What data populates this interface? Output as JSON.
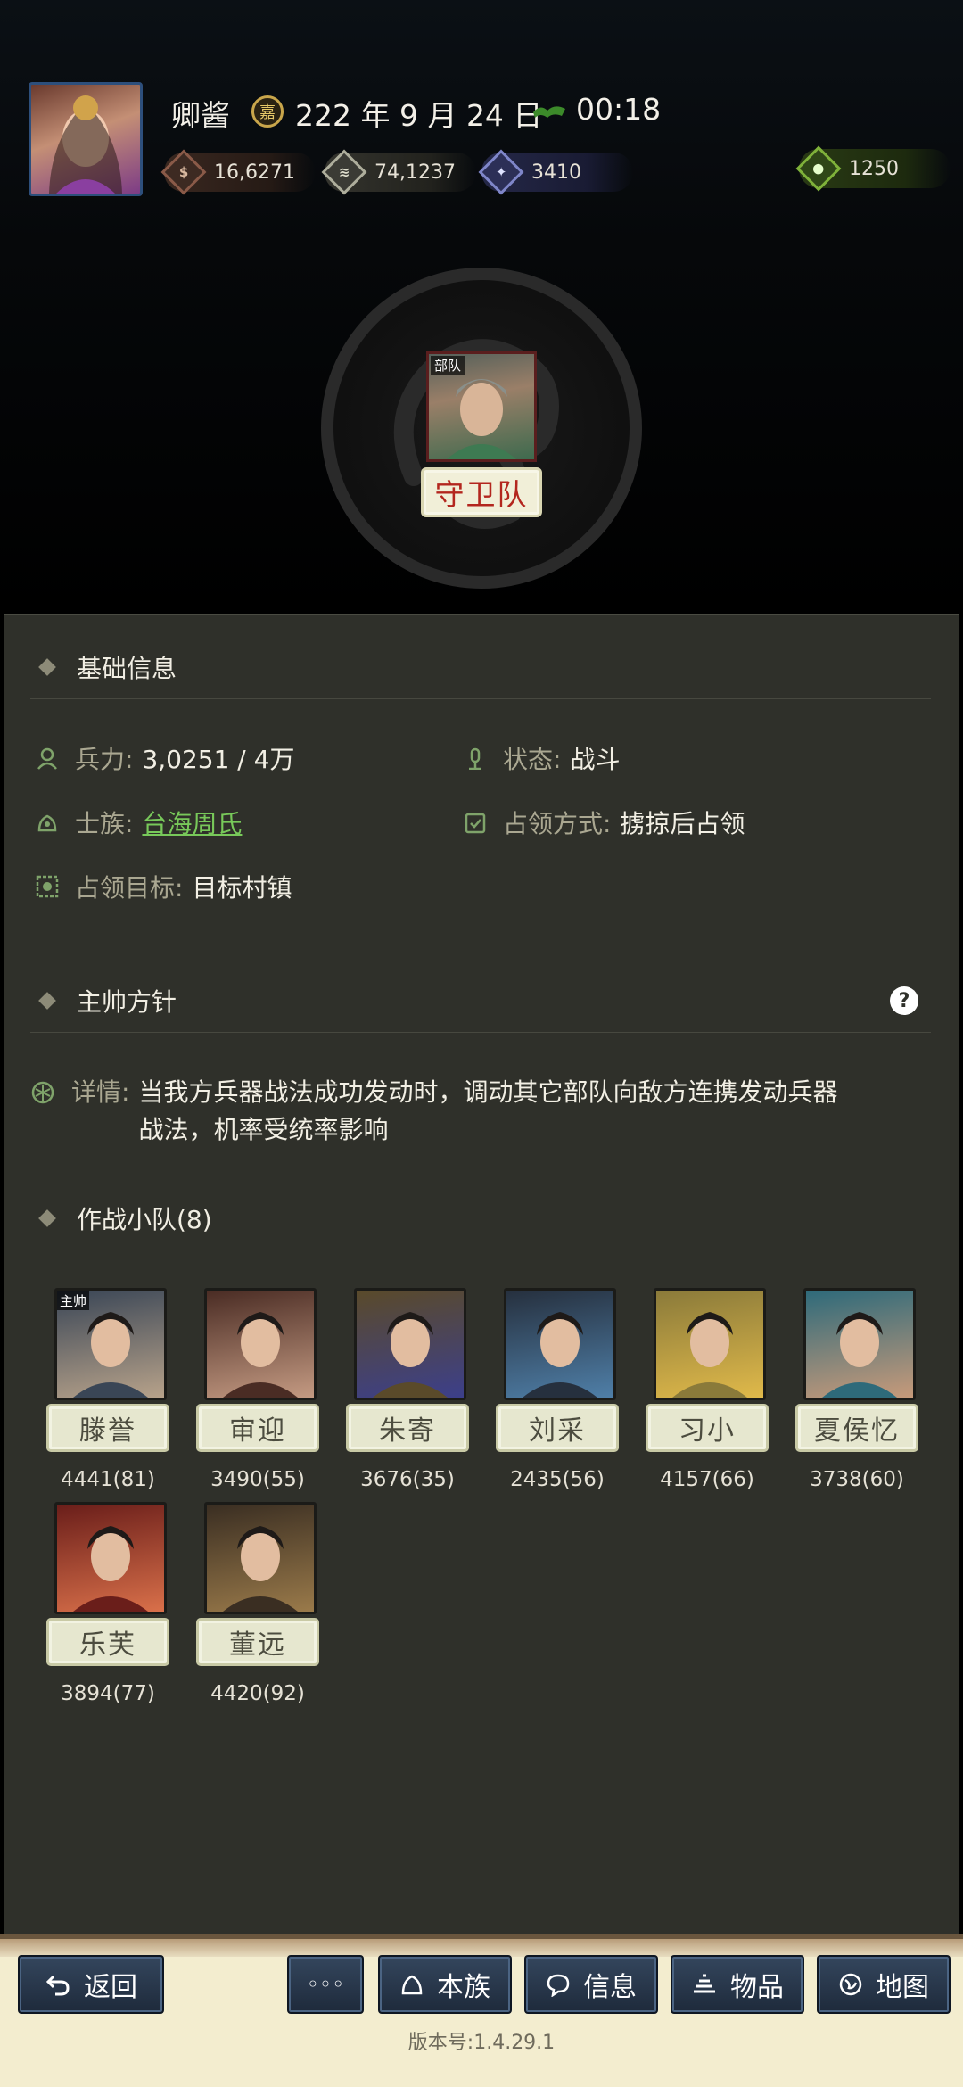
{
  "header": {
    "player_name": "卿酱",
    "date_icon": "嘉",
    "date": "222 年 9 月 24 日",
    "time": "00:18",
    "resources": {
      "money": "16,6271",
      "grain": "74,1237",
      "manpower": "3410",
      "jade": "1250"
    }
  },
  "troop": {
    "tag": "部队",
    "name": "守卫队"
  },
  "basic_info": {
    "title": "基础信息",
    "troops_label": "兵力:",
    "troops_value": "3,0251 / 4万",
    "status_label": "状态:",
    "status_value": "战斗",
    "clan_label": "士族:",
    "clan_value": "台海周氏",
    "occupy_mode_label": "占领方式:",
    "occupy_mode_value": "掳掠后占领",
    "target_label": "占领目标:",
    "target_value": "目标村镇"
  },
  "policy": {
    "title": "主帅方针",
    "detail_label": "详情:",
    "detail_line1": "当我方兵器战法成功发动时，调动其它部队向敌方连携发动兵器",
    "detail_line2": "战法，机率受统率影响"
  },
  "squad": {
    "title": "作战小队(8)",
    "leader_tag": "主帅",
    "members": [
      {
        "name": "滕誉",
        "stats": "4441(81)",
        "color_a": "#3a4656",
        "color_b": "#b7a28a"
      },
      {
        "name": "审迎",
        "stats": "3490(55)",
        "color_a": "#4a2c24",
        "color_b": "#c49a82"
      },
      {
        "name": "朱寄",
        "stats": "3676(35)",
        "color_a": "#5a4a2a",
        "color_b": "#3c3f8a"
      },
      {
        "name": "刘采",
        "stats": "2435(56)",
        "color_a": "#26303e",
        "color_b": "#4f7fa8"
      },
      {
        "name": "习小",
        "stats": "4157(66)",
        "color_a": "#8a7a3a",
        "color_b": "#e0b94a"
      },
      {
        "name": "夏侯忆",
        "stats": "3738(60)",
        "color_a": "#2e6a7a",
        "color_b": "#c79a7a"
      },
      {
        "name": "乐芙",
        "stats": "3894(77)",
        "color_a": "#6a1e1a",
        "color_b": "#d9704a"
      },
      {
        "name": "董远",
        "stats": "4420(92)",
        "color_a": "#3a2e22",
        "color_b": "#9a7a4a"
      }
    ]
  },
  "bottom_bar": {
    "back": "返回",
    "more": "◦◦◦",
    "clan": "本族",
    "info": "信息",
    "items": "物品",
    "map": "地图",
    "version": "版本号:1.4.29.1"
  }
}
